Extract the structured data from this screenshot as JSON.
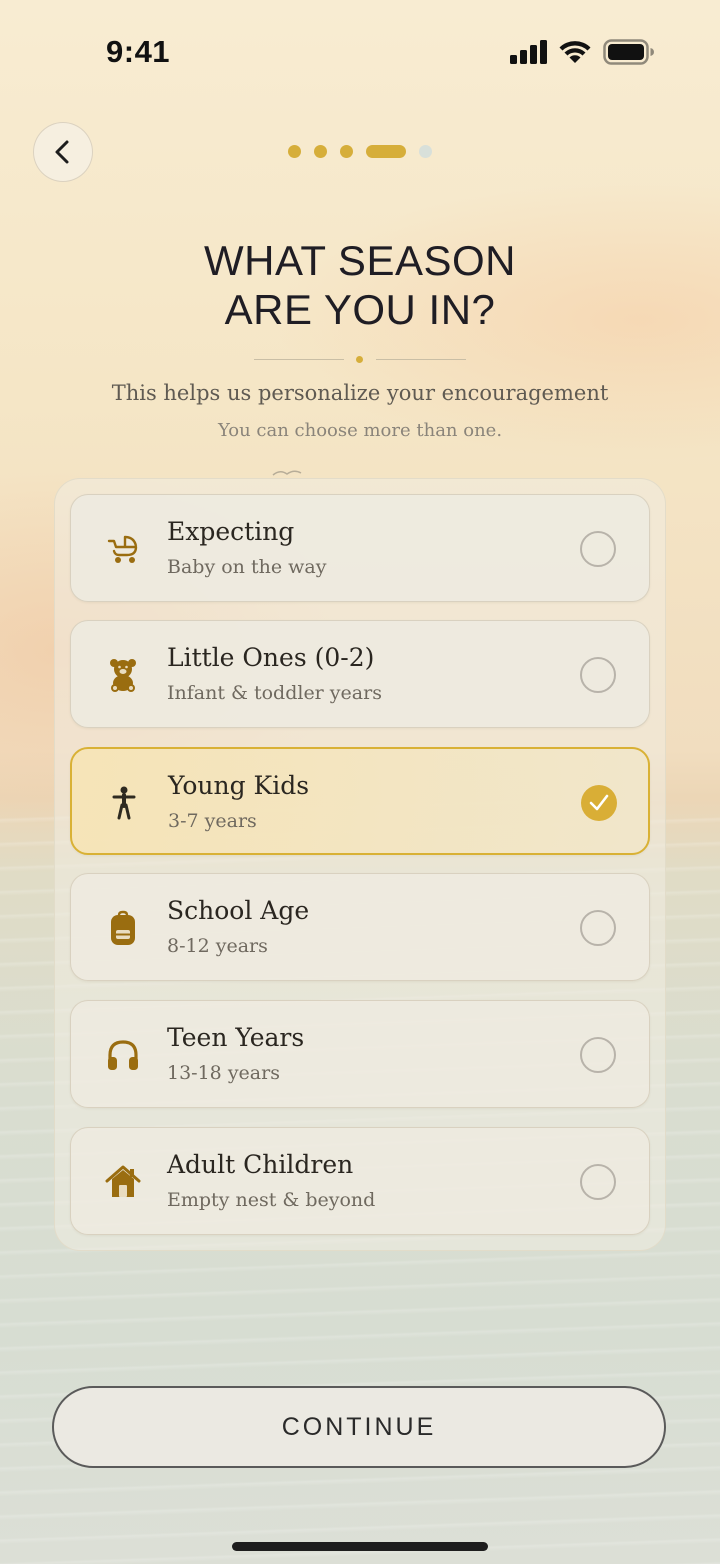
{
  "status_bar": {
    "time": "9:41"
  },
  "progress": {
    "total_steps": 5,
    "current_step": 4
  },
  "header": {
    "title_line1": "WHAT SEASON",
    "title_line2": "ARE YOU IN?",
    "subtitle": "This helps us personalize your encouragement",
    "hint": "You can choose more than one."
  },
  "options": [
    {
      "label": "Expecting",
      "sub": "Baby on the way",
      "icon": "stroller-icon",
      "selected": false
    },
    {
      "label": "Little Ones (0-2)",
      "sub": "Infant & toddler years",
      "icon": "teddy-bear-icon",
      "selected": false
    },
    {
      "label": "Young Kids",
      "sub": "3-7 years",
      "icon": "child-icon",
      "selected": true
    },
    {
      "label": "School Age",
      "sub": "8-12 years",
      "icon": "backpack-icon",
      "selected": false
    },
    {
      "label": "Teen Years",
      "sub": "13-18 years",
      "icon": "headphones-icon",
      "selected": false
    },
    {
      "label": "Adult Children",
      "sub": "Empty nest & beyond",
      "icon": "house-icon",
      "selected": false
    }
  ],
  "footer": {
    "continue_label": "CONTINUE"
  },
  "colors": {
    "accent": "#d9ae36",
    "icon": "#9a6d10",
    "text": "#2a2620"
  }
}
